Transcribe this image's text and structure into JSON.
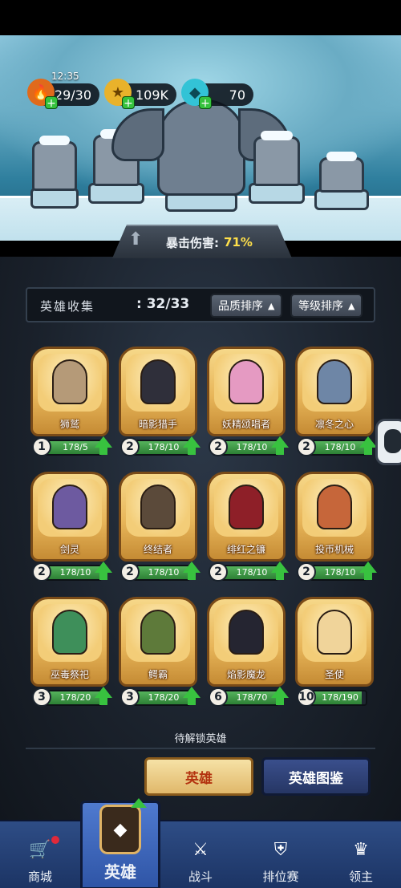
{
  "status": {
    "time": "12:35"
  },
  "resources": [
    {
      "name": "stamina",
      "icon": "flame-icon",
      "value": "29/30",
      "color": "#e06a1b"
    },
    {
      "name": "gold",
      "icon": "coin-icon",
      "value": "109K",
      "color": "#e9b22b"
    },
    {
      "name": "gems",
      "icon": "gem-icon",
      "value": "70",
      "color": "#33c3d6"
    }
  ],
  "crit": {
    "label": "暴击伤害:",
    "value": "71%"
  },
  "collection": {
    "title": "英雄收集",
    "count": ": 32/33",
    "sort_quality": "品质排序",
    "sort_level": "等级排序"
  },
  "heroes": [
    {
      "name": "狮鹫",
      "level": "1",
      "progress": "178/5",
      "fill": 1.0,
      "color": "#b59a78"
    },
    {
      "name": "暗影猎手",
      "level": "2",
      "progress": "178/10",
      "fill": 1.0,
      "color": "#2f2f3a"
    },
    {
      "name": "妖精颂唱者",
      "level": "2",
      "progress": "178/10",
      "fill": 1.0,
      "color": "#e59ac2"
    },
    {
      "name": "凛冬之心",
      "level": "2",
      "progress": "178/10",
      "fill": 1.0,
      "color": "#6e86a6"
    },
    {
      "name": "剑灵",
      "level": "2",
      "progress": "178/10",
      "fill": 1.0,
      "color": "#6d5aa0"
    },
    {
      "name": "终结者",
      "level": "2",
      "progress": "178/10",
      "fill": 1.0,
      "color": "#5b4a3a"
    },
    {
      "name": "绯红之镰",
      "level": "2",
      "progress": "178/10",
      "fill": 1.0,
      "color": "#8e1f28"
    },
    {
      "name": "投币机械",
      "level": "2",
      "progress": "178/10",
      "fill": 1.0,
      "color": "#c6663a"
    },
    {
      "name": "巫毒祭祀",
      "level": "3",
      "progress": "178/20",
      "fill": 1.0,
      "color": "#3e8f5a"
    },
    {
      "name": "鳄霸",
      "level": "3",
      "progress": "178/20",
      "fill": 1.0,
      "color": "#5e7a3a"
    },
    {
      "name": "焰影魔龙",
      "level": "6",
      "progress": "178/70",
      "fill": 1.0,
      "color": "#252531"
    },
    {
      "name": "圣使",
      "level": "10",
      "progress": "178/190",
      "fill": 0.94,
      "color": "#f0d49a"
    }
  ],
  "locked_label": "待解锁英雄",
  "buttons": {
    "heroes": "英雄",
    "codex": "英雄图鉴"
  },
  "nav": [
    {
      "label": "商城",
      "icon": "shop-icon"
    },
    {
      "label": "英雄",
      "icon": "hero-card-icon",
      "active": true
    },
    {
      "label": "战斗",
      "icon": "crossed-swords-icon"
    },
    {
      "label": "排位赛",
      "icon": "ranked-shield-icon"
    },
    {
      "label": "领主",
      "icon": "crown-icon"
    }
  ]
}
